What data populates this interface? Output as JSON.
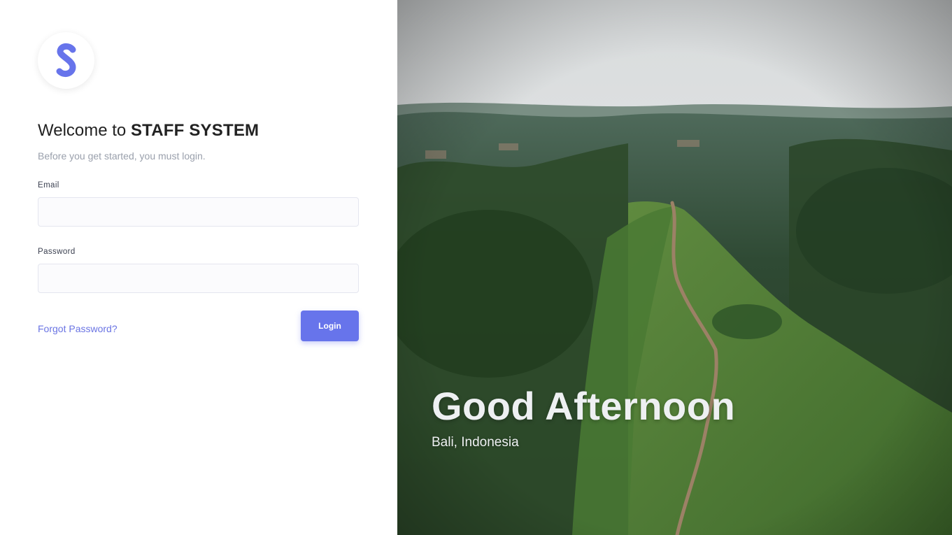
{
  "brand": {
    "logo_letter": "S",
    "accent_color": "#6774eb"
  },
  "login": {
    "welcome_prefix": "Welcome to ",
    "system_name": "STAFF SYSTEM",
    "subtitle": "Before you get started, you must login.",
    "email_label": "Email",
    "email_value": "",
    "password_label": "Password",
    "password_value": "",
    "forgot_label": "Forgot Password?",
    "login_label": "Login"
  },
  "hero": {
    "greeting": "Good Afternoon",
    "location": "Bali, Indonesia"
  }
}
